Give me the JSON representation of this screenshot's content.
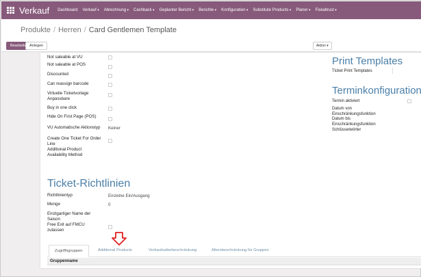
{
  "app": {
    "brand": "Verkauf",
    "menu": [
      {
        "label": "Dashboard",
        "dropdown": false
      },
      {
        "label": "Verkauf",
        "dropdown": true
      },
      {
        "label": "Abrechnung",
        "dropdown": true
      },
      {
        "label": "Cashback",
        "dropdown": true
      },
      {
        "label": "Geplanter Bericht",
        "dropdown": true
      },
      {
        "label": "Berichte",
        "dropdown": true
      },
      {
        "label": "Konfiguration",
        "dropdown": true
      },
      {
        "label": "Substitute Products",
        "dropdown": true
      },
      {
        "label": "Planer",
        "dropdown": true
      },
      {
        "label": "Fiskaltrust",
        "dropdown": true
      }
    ]
  },
  "breadcrumb": {
    "items": [
      "Produkte",
      "Herren"
    ],
    "current": "Card Gentlemen Template",
    "separator": "/"
  },
  "buttons": {
    "edit": "Bearbeiten",
    "create": "Anlegen",
    "action": "Aktion"
  },
  "fields_left": [
    {
      "label": "Not saleable at VU",
      "type": "checkbox",
      "checked": false
    },
    {
      "label": "Not saleable at POS",
      "type": "checkbox",
      "checked": false
    },
    {
      "label": "Discounted",
      "type": "checkbox",
      "checked": false
    },
    {
      "label": "Can reassign barcode",
      "type": "checkbox",
      "checked": false
    },
    {
      "label": "Virtuelle Ticketvorlage Anpassbare",
      "type": "checkbox",
      "checked": false
    },
    {
      "label": "Buy in one click",
      "type": "checkbox",
      "checked": false
    },
    {
      "label": "Hide On First Page (POS)",
      "type": "checkbox",
      "checked": false
    },
    {
      "label": "VU Automatische Aktionstyp",
      "type": "value",
      "value": "Keiner"
    },
    {
      "label": "Create One Ticket For Order Line",
      "type": "checkbox",
      "checked": false
    },
    {
      "label": "Additional Product Availability Method",
      "type": "empty"
    }
  ],
  "print_templates": {
    "heading": "Print Templates",
    "fields": [
      {
        "label": "Ticket Print Templates"
      }
    ]
  },
  "terminkonfiguration": {
    "heading": "Terminkonfiguration",
    "fields": [
      {
        "label": "Termin aktiviert",
        "type": "checkbox",
        "checked": false
      },
      {
        "label": "Datum von Einschränkungsfunktion",
        "type": "empty"
      },
      {
        "label": "Datum bis Einschränkungsfunktion",
        "type": "empty"
      },
      {
        "label": "Schlüsselwörter",
        "type": "empty"
      }
    ]
  },
  "ticket_richtlinien": {
    "heading": "Ticket-Richtlinien",
    "fields": [
      {
        "label": "Richtlinientyp",
        "type": "value",
        "value": "Einzelne Ein/Ausgang"
      },
      {
        "label": "Menge",
        "type": "value",
        "value": "0"
      },
      {
        "label": "Einzigartiger Name der Saison",
        "type": "empty"
      },
      {
        "label": "Free Exit auf FMCU zulassen",
        "type": "checkbox",
        "checked": false
      }
    ]
  },
  "tabs": {
    "items": [
      "Zugriffsgruppen",
      "Additional Products",
      "Verkaufsalterbeschränkung",
      "Altersbeschränkung für Gruppen"
    ],
    "active_index": 0
  },
  "table": {
    "columns": [
      "Gruppenname"
    ]
  },
  "colors": {
    "navbar": "#875a7b",
    "heading": "#4a7fa8",
    "annotation_arrow": "#e02020"
  }
}
